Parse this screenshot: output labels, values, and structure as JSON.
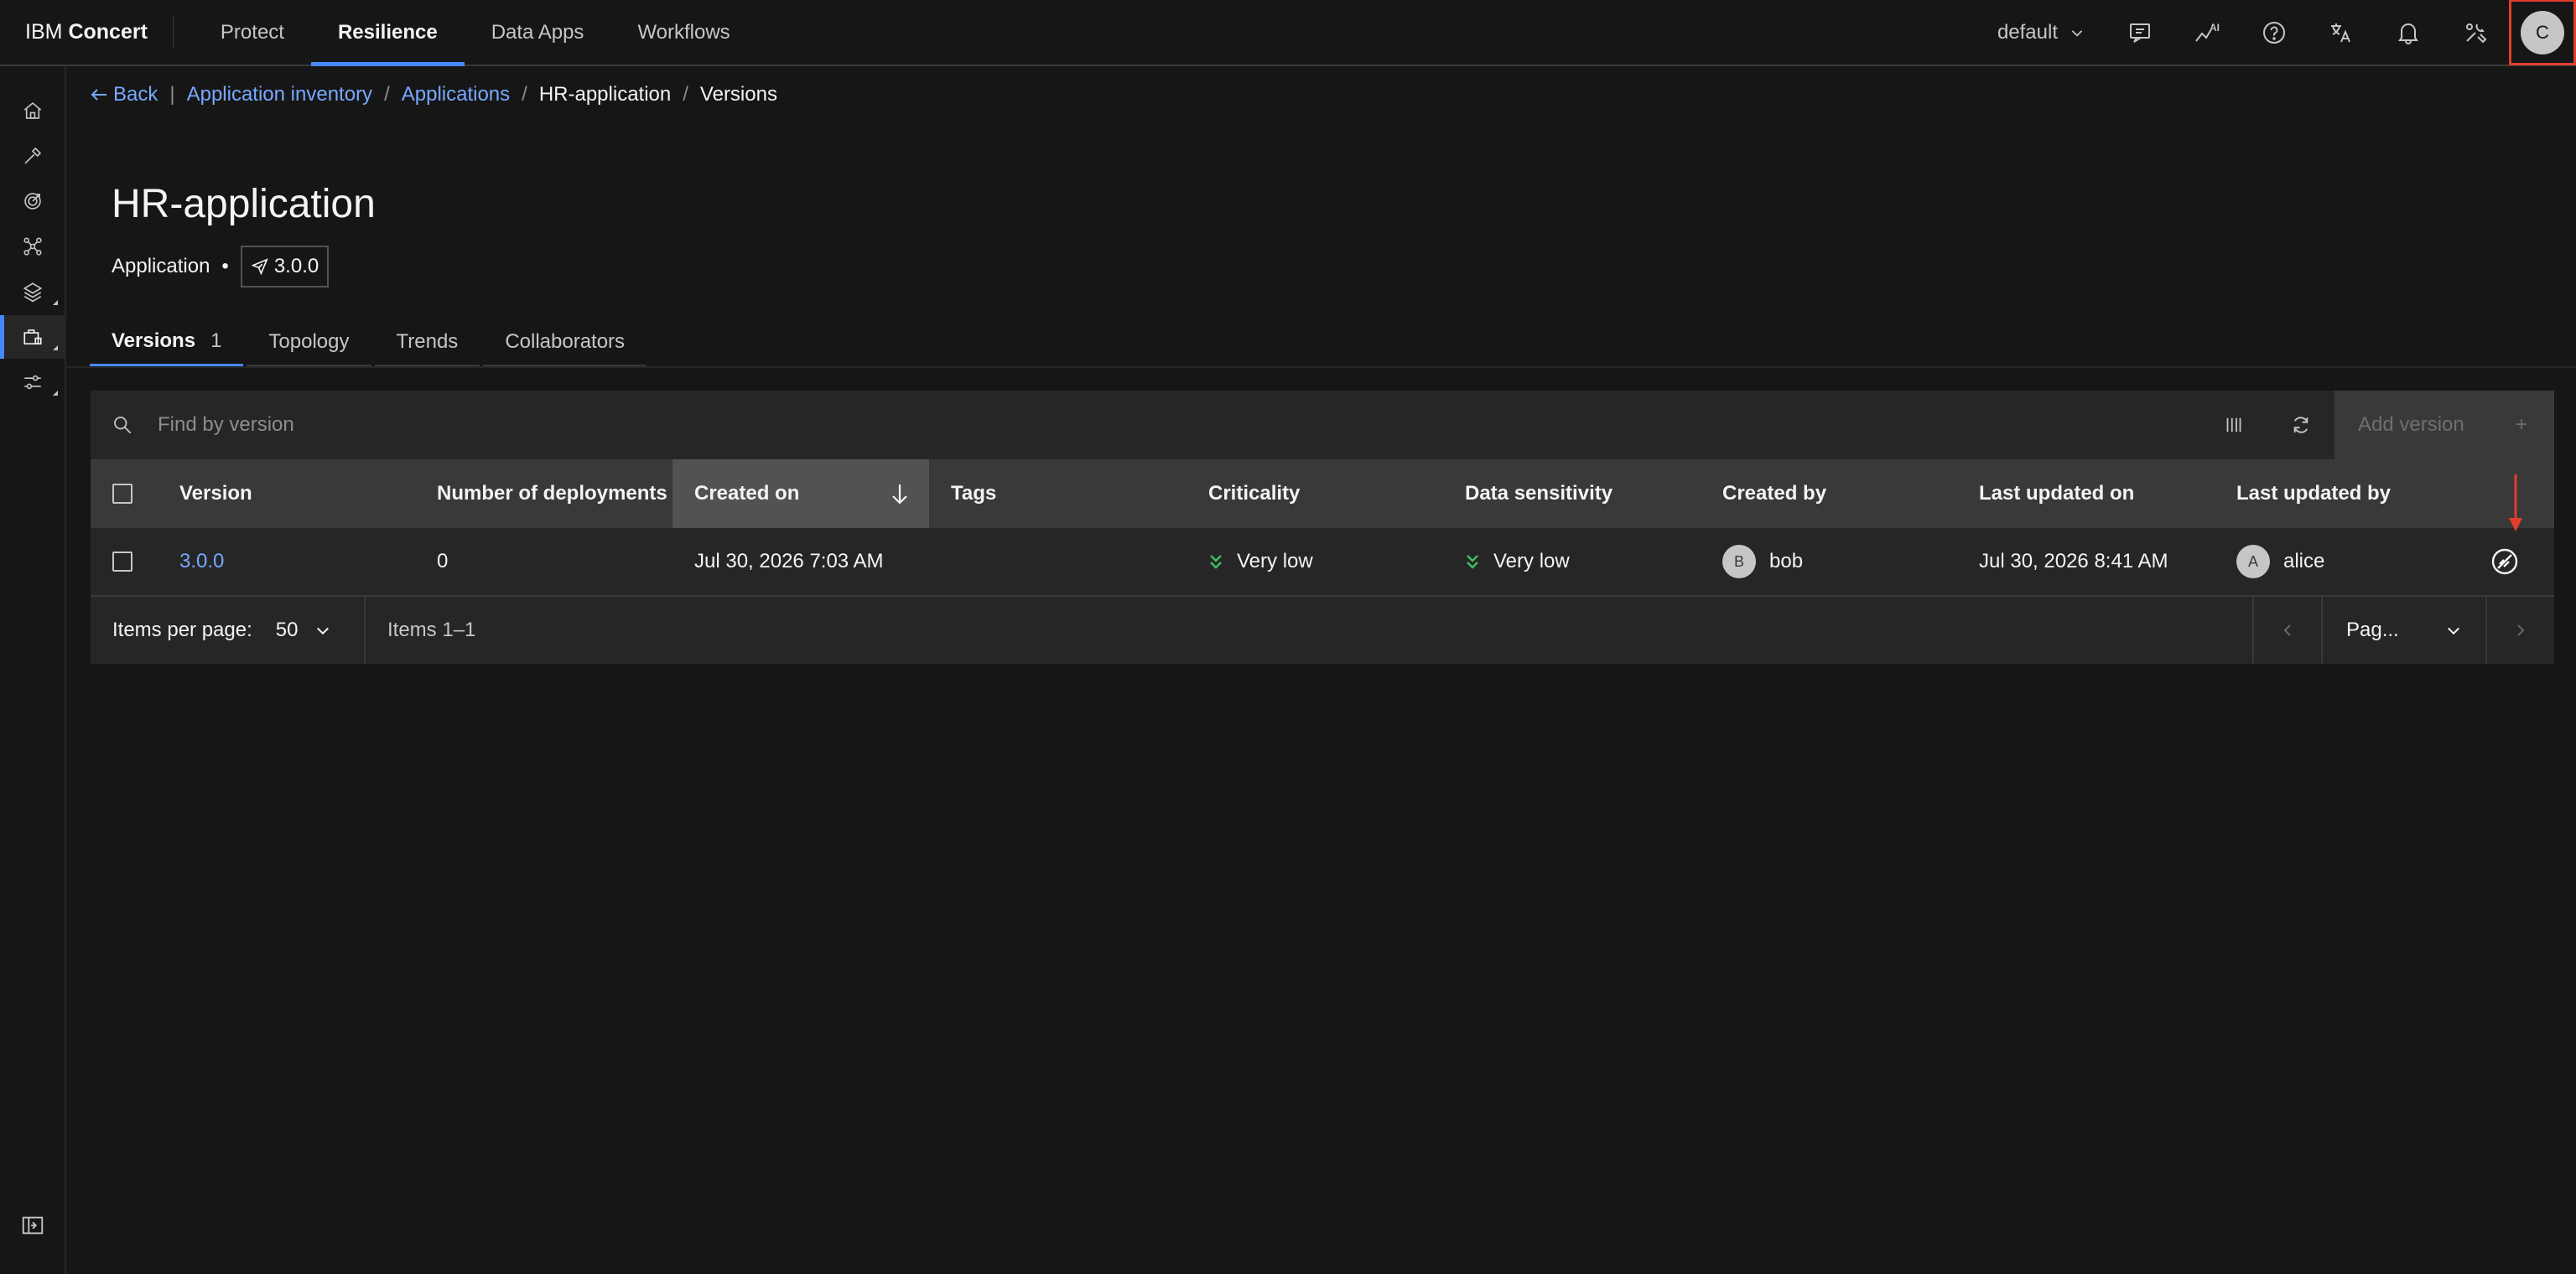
{
  "header": {
    "brand_prefix": "IBM",
    "brand_name": "Concert",
    "nav": [
      "Protect",
      "Resilience",
      "Data Apps",
      "Workflows"
    ],
    "active_nav": "Resilience",
    "environment": "default",
    "avatar_initial": "C",
    "icons": [
      "feedback-icon",
      "ai-insights-icon",
      "help-icon",
      "translate-icon",
      "notification-icon",
      "tools-icon"
    ]
  },
  "sidebar": {
    "items": [
      "home-icon",
      "tools-icon",
      "target-icon",
      "network-icon",
      "layers-icon",
      "applications-icon",
      "settings-adjust-icon"
    ],
    "active": "applications-icon",
    "footer_icon": "panel-expand-icon"
  },
  "breadcrumb": {
    "back": "Back",
    "items": [
      "Application inventory",
      "Applications",
      "HR-application",
      "Versions"
    ]
  },
  "page": {
    "title": "HR-application",
    "type": "Application",
    "bullet": "•",
    "version": "3.0.0"
  },
  "tabs": [
    {
      "label": "Versions",
      "count": "1"
    },
    {
      "label": "Topology"
    },
    {
      "label": "Trends"
    },
    {
      "label": "Collaborators"
    }
  ],
  "toolbar": {
    "search_placeholder": "Find by version",
    "add_label": "Add version",
    "add_icon": "+"
  },
  "table": {
    "headers": {
      "version": "Version",
      "deployments": "Number of deployments",
      "created_on": "Created on",
      "tags": "Tags",
      "criticality": "Criticality",
      "sensitivity": "Data sensitivity",
      "created_by": "Created by",
      "last_updated_on": "Last updated on",
      "last_updated_by": "Last updated by"
    },
    "sorted_column": "created_on",
    "sort_direction": "descending",
    "rows": [
      {
        "version": "3.0.0",
        "deployments": "0",
        "created_on": "Jul 30, 2026 7:03 AM",
        "tags": "",
        "criticality": "Very low",
        "sensitivity": "Very low",
        "created_by": "bob",
        "created_by_initial": "B",
        "last_updated_on": "Jul 30, 2026 8:41 AM",
        "last_updated_by": "alice",
        "last_updated_by_initial": "A"
      }
    ]
  },
  "pagination": {
    "items_per_page_label": "Items per page:",
    "items_per_page": "50",
    "range": "Items 1–1",
    "page_select": "Pag..."
  },
  "colors": {
    "accent": "#4589ff",
    "link": "#78a9ff",
    "level_low": "#42be65",
    "annotation": "#e23d2d"
  }
}
